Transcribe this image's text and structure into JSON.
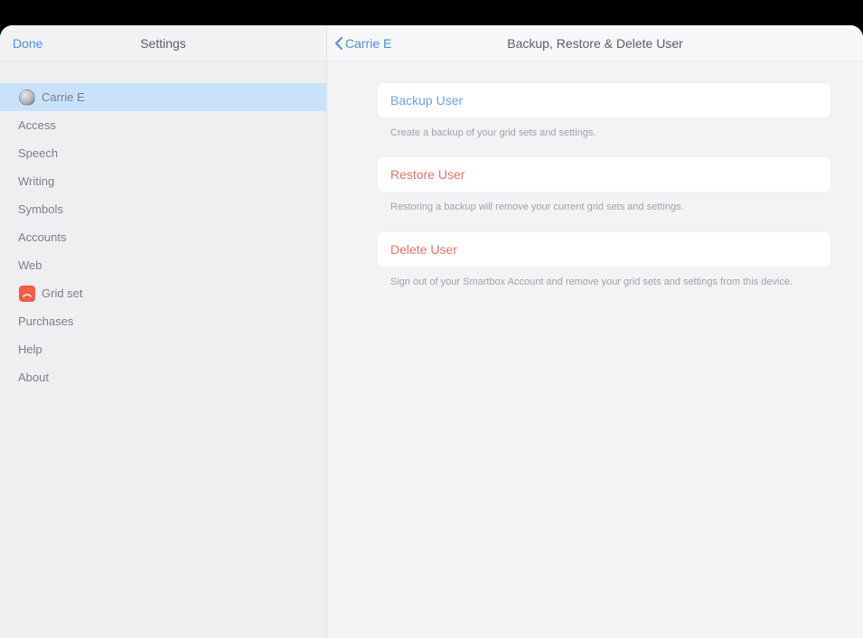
{
  "sidebar": {
    "done_label": "Done",
    "title": "Settings",
    "user": {
      "name": "Carrie E"
    },
    "items": [
      {
        "label": "Access"
      },
      {
        "label": "Speech"
      },
      {
        "label": "Writing"
      },
      {
        "label": "Symbols"
      },
      {
        "label": "Accounts"
      },
      {
        "label": "Web"
      },
      {
        "label": "Grid set",
        "icon": "grid-set"
      },
      {
        "label": "Purchases"
      },
      {
        "label": "Help"
      },
      {
        "label": "About"
      }
    ]
  },
  "main": {
    "back_label": "Carrie E",
    "title": "Backup, Restore & Delete User",
    "backup": {
      "title": "Backup User",
      "desc": "Create a backup of your grid sets and settings."
    },
    "restore": {
      "title": "Restore User",
      "desc": "Restoring a backup will remove your current grid sets and settings."
    },
    "delete": {
      "title": "Delete User",
      "desc": "Sign out of your Smartbox Account and remove your grid sets and settings from this device."
    }
  }
}
